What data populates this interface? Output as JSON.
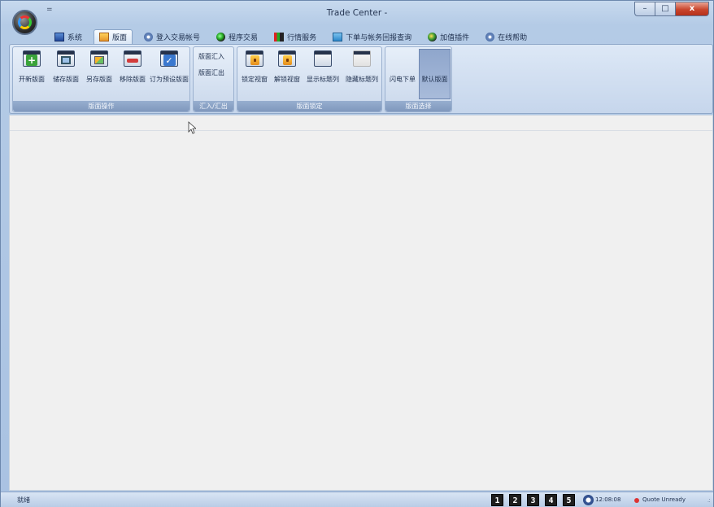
{
  "window": {
    "title": "Trade Center -",
    "minimize_glyph": "–",
    "maximize_glyph": "□",
    "close_glyph": "x",
    "quick_access_glyph": "=",
    "accent": "#c9452c"
  },
  "menu": {
    "tabs": [
      {
        "label": "系统",
        "icon": "system-icon"
      },
      {
        "label": "版面",
        "icon": "layout-icon",
        "active": true
      },
      {
        "label": "登入交易帐号",
        "icon": "login-icon"
      },
      {
        "label": "程序交易",
        "icon": "program-icon"
      },
      {
        "label": "行情服务",
        "icon": "quote-icon"
      },
      {
        "label": "下单与帐务回报查询",
        "icon": "order-icon"
      },
      {
        "label": "加值插件",
        "icon": "plugin-icon"
      },
      {
        "label": "在线帮助",
        "icon": "help-icon"
      }
    ]
  },
  "ribbon": {
    "layout_ops": {
      "label": "版面操作",
      "buttons": [
        {
          "label": "开新版面",
          "glyph": "+"
        },
        {
          "label": "储存版面",
          "glyph": ""
        },
        {
          "label": "另存版面",
          "glyph": ""
        },
        {
          "label": "移除版面",
          "glyph": ""
        },
        {
          "label": "订为预设版面",
          "glyph": "✓"
        }
      ]
    },
    "import_export": {
      "label": "汇入/汇出",
      "import_label": "版面汇入",
      "export_label": "版面汇出"
    },
    "layout_lock": {
      "label": "版面锁定",
      "buttons": [
        {
          "label": "锁定视窗"
        },
        {
          "label": "解锁视窗"
        },
        {
          "label": "显示标题列"
        },
        {
          "label": "隐藏标题列"
        }
      ]
    },
    "layout_select": {
      "label": "版面选择",
      "buttons": [
        {
          "label": "闪电下单"
        },
        {
          "label": "默认版面",
          "selected": true
        }
      ]
    }
  },
  "statusbar": {
    "status": "就绪",
    "digits": [
      "1",
      "2",
      "3",
      "4",
      "5"
    ],
    "time": "12:08:08",
    "quote_status": "Quote Unready",
    "quote_color": "#dd3333"
  }
}
